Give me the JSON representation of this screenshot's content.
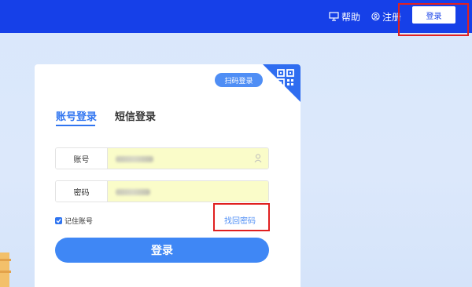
{
  "header": {
    "help_label": "帮助",
    "register_label": "注册",
    "login_label": "登录"
  },
  "card": {
    "scan_login_label": "扫码登录",
    "tabs": [
      {
        "label": "账号登录",
        "active": true
      },
      {
        "label": "短信登录",
        "active": false
      }
    ],
    "account_field": {
      "label": "账号"
    },
    "password_field": {
      "label": "密码"
    },
    "remember_label": "记住账号",
    "remember_checked": true,
    "forgot_label": "找回密码",
    "submit_label": "登录"
  },
  "colors": {
    "header_bg": "#1640e8",
    "accent": "#3f87f5",
    "autofill_bg": "#fafcc9",
    "highlight": "#e02020"
  }
}
